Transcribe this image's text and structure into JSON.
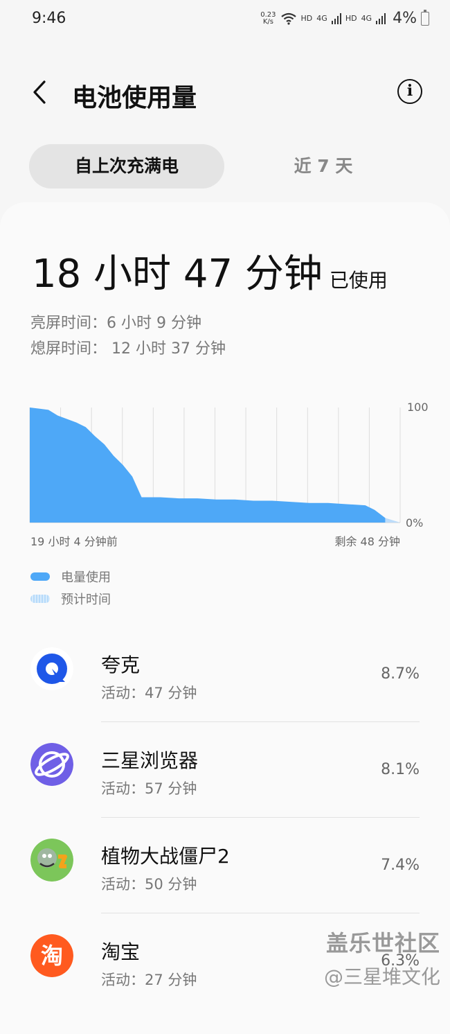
{
  "status_bar": {
    "time": "9:46",
    "speed": "0.23",
    "speed_unit": "K/s",
    "hd1": "HD",
    "net1": "4G",
    "hd2": "HD",
    "net2": "4G",
    "battery": "4%"
  },
  "header": {
    "title": "电池使用量"
  },
  "tabs": {
    "since_full": "自上次充满电",
    "last7": "近 7 天"
  },
  "summary": {
    "total": "18 小时 47 分钟",
    "total_suffix": "已使用",
    "screen_on": "亮屏时间：6 小时 9 分钟",
    "screen_off": "熄屏时间： 12 小时 37 分钟"
  },
  "chart_data": {
    "type": "area",
    "y_ticks": [
      "100",
      "0%"
    ],
    "ylim": [
      0,
      100
    ],
    "x_start_label": "19 小时 4 分钟前",
    "x_end_label": "剩余 48 分钟",
    "series": [
      {
        "name": "电量使用",
        "color": "#4ea8f7",
        "x": [
          0,
          0.5,
          1.0,
          1.5,
          2.0,
          2.5,
          3.0,
          3.5,
          4.0,
          4.5,
          5.0,
          5.5,
          6.0,
          7,
          8,
          9,
          10,
          11,
          12,
          13,
          14,
          15,
          16,
          17,
          18,
          18.5,
          19.07
        ],
        "y": [
          100,
          99,
          98,
          93,
          90,
          87,
          83,
          75,
          68,
          58,
          50,
          40,
          22,
          22,
          21,
          21,
          20,
          20,
          19,
          19,
          18,
          17,
          17,
          16,
          15,
          11,
          4
        ]
      },
      {
        "name": "预计时间",
        "color": "#bcdcfa",
        "x": [
          19.07,
          19.87
        ],
        "y": [
          4,
          0
        ]
      }
    ]
  },
  "apps": [
    {
      "name": "夸克",
      "active": "活动：47 分钟",
      "percent": "8.7%",
      "icon": "quark-icon"
    },
    {
      "name": "三星浏览器",
      "active": "活动：57 分钟",
      "percent": "8.1%",
      "icon": "samsung-browser-icon"
    },
    {
      "name": "植物大战僵尸2",
      "active": "活动：50 分钟",
      "percent": "7.4%",
      "icon": "pvz2-icon"
    },
    {
      "name": "淘宝",
      "active": "活动：27 分钟",
      "percent": "6.3%",
      "icon": "taobao-icon"
    }
  ],
  "watermark": {
    "line1": "盖乐世社区",
    "line2": "@三星堆文化"
  }
}
